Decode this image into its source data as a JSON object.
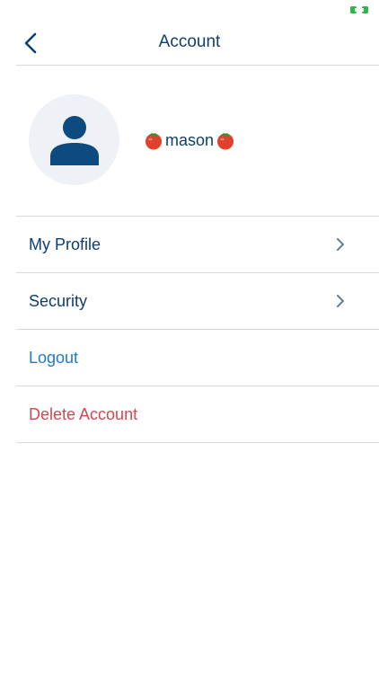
{
  "screen": {
    "title": "Account"
  },
  "profile": {
    "username": "mason",
    "decoration_emoji": "tomato"
  },
  "menu": {
    "items": [
      {
        "label": "My Profile",
        "style": "default",
        "has_chevron": true
      },
      {
        "label": "Security",
        "style": "default",
        "has_chevron": true
      },
      {
        "label": "Logout",
        "style": "link",
        "has_chevron": false
      },
      {
        "label": "Delete Account",
        "style": "danger",
        "has_chevron": false
      }
    ]
  },
  "colors": {
    "primary": "#0d3f6e",
    "link": "#1a7ad8",
    "danger": "#d9444f",
    "avatar_bg": "#eef1f5",
    "divider": "#d9d9d9",
    "battery": "#2fb84a"
  },
  "icons": {
    "back": "chevron-left-icon",
    "avatar": "user-icon",
    "row_chevron": "chevron-right-icon",
    "battery": "battery-icon"
  }
}
